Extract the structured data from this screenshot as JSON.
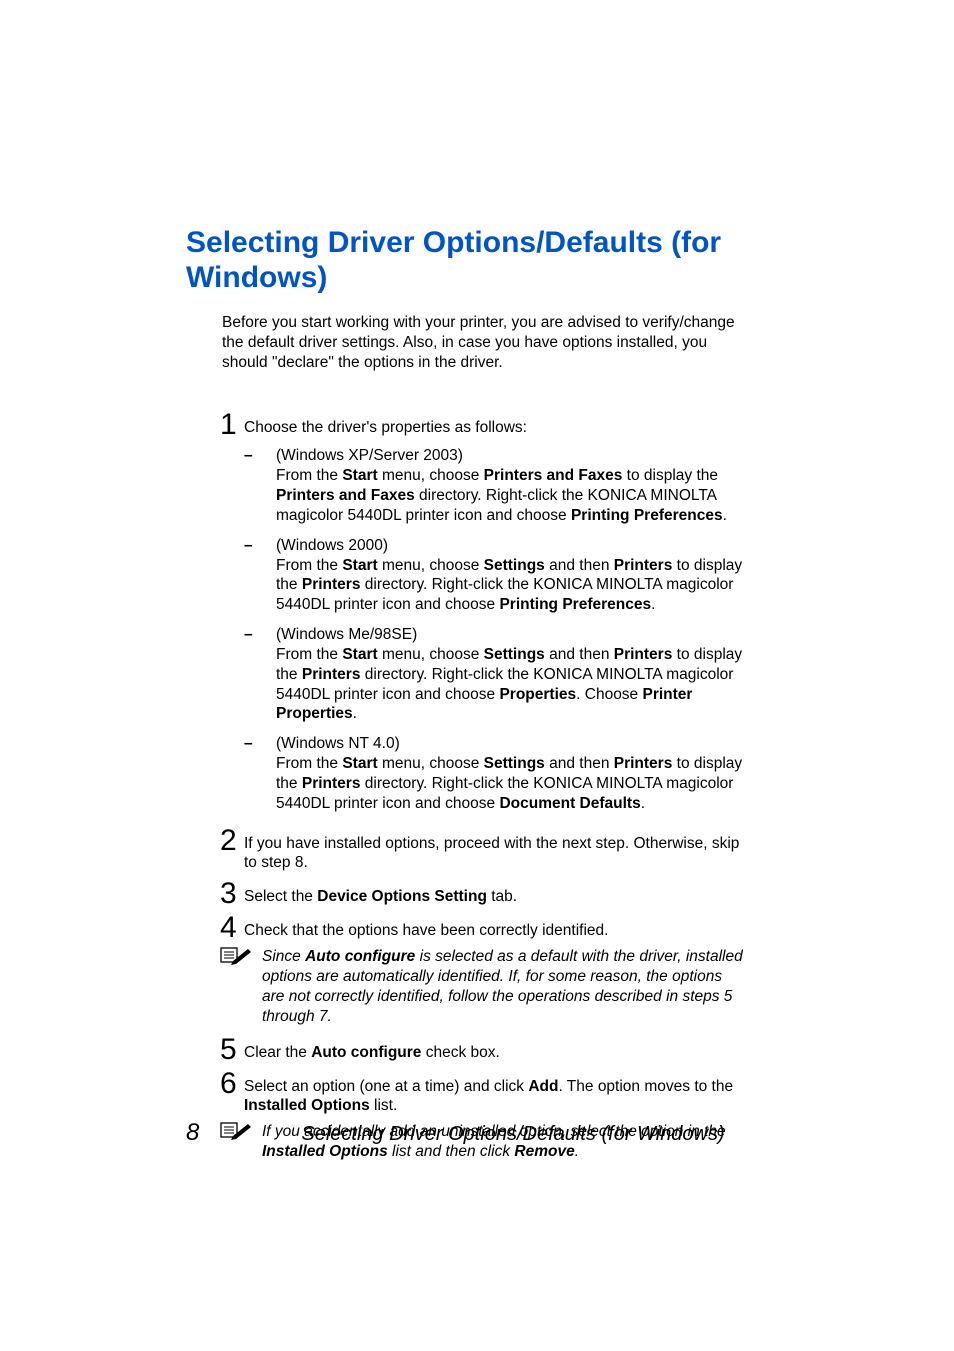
{
  "title": "Selecting Driver Options/Defaults (for Windows)",
  "intro": "Before you start working with your printer, you are advised to verify/change the default driver settings. Also, in case you have options installed, you should \"declare\" the options in the driver.",
  "steps": {
    "s1": {
      "num": "1",
      "text": "Choose the driver's properties as follows:",
      "subs": {
        "a_label": "(Windows XP/Server 2003)",
        "a_from": "From the ",
        "a_start": "Start",
        "a_mid1": " menu, choose ",
        "a_pf1": "Printers and Faxes",
        "a_mid2": " to display the ",
        "a_pf2": "Printers and Faxes",
        "a_mid3": " directory. Right-click the KONICA MINOLTA magicolor 5440DL printer icon and choose ",
        "a_pp": "Printing Preferences",
        "a_end": ".",
        "b_label": "(Windows 2000)",
        "b_from": "From the ",
        "b_start": "Start",
        "b_mid1": " menu, choose ",
        "b_settings": "Settings",
        "b_mid2": " and then ",
        "b_printers": "Printers",
        "b_mid3": " to display the ",
        "b_printers2": "Printers",
        "b_mid4": " directory. Right-click the KONICA MINOLTA magicolor 5440DL printer icon and choose ",
        "b_pp": "Printing Preferences",
        "b_end": ".",
        "c_label": "(Windows Me/98SE)",
        "c_from": "From the ",
        "c_start": "Start",
        "c_mid1": " menu, choose ",
        "c_settings": "Settings",
        "c_mid2": " and then ",
        "c_printers": "Printers",
        "c_mid3": " to display the ",
        "c_printers2": "Printers",
        "c_mid4": " directory. Right-click the KONICA MINOLTA magicolor 5440DL printer icon and choose ",
        "c_props": "Properties",
        "c_mid5": ". Choose ",
        "c_pprops": "Printer Properties",
        "c_end": ".",
        "d_label": "(Windows NT 4.0)",
        "d_from": "From the ",
        "d_start": "Start",
        "d_mid1": " menu, choose ",
        "d_settings": "Settings",
        "d_mid2": " and then ",
        "d_printers": "Printers",
        "d_mid3": " to display the ",
        "d_printers2": "Printers",
        "d_mid4": " directory. Right-click the KONICA MINOLTA magicolor 5440DL printer icon and choose ",
        "d_dd": "Document Defaults",
        "d_end": "."
      }
    },
    "s2": {
      "num": "2",
      "text": "If you have installed options, proceed with the next step. Otherwise, skip to step 8."
    },
    "s3": {
      "num": "3",
      "pre": "Select the ",
      "bold": "Device Options Setting",
      "post": " tab."
    },
    "s4": {
      "num": "4",
      "text": "Check that the options have been correctly identified."
    },
    "note1": {
      "pre": "Since ",
      "bold": "Auto configure",
      "post": " is selected as a default with the driver, installed options are automatically identified. If, for some reason, the options are not correctly identified, follow the operations described in steps 5 through 7."
    },
    "s5": {
      "num": "5",
      "pre": "Clear the ",
      "bold": "Auto configure",
      "post": " check box."
    },
    "s6": {
      "num": "6",
      "pre": "Select an option (one at a time) and click ",
      "bold1": "Add",
      "mid": ". The option moves to the ",
      "bold2": "Installed Options",
      "post": " list."
    },
    "note2": {
      "pre": "If you accidentally add an uninstalled option, select the option in the ",
      "bold1": "Installed Options",
      "mid": " list and then click ",
      "bold2": "Remove",
      "post": "."
    }
  },
  "footer": {
    "page": "8",
    "text": "Selecting Driver Options/Defaults (for Windows)"
  }
}
